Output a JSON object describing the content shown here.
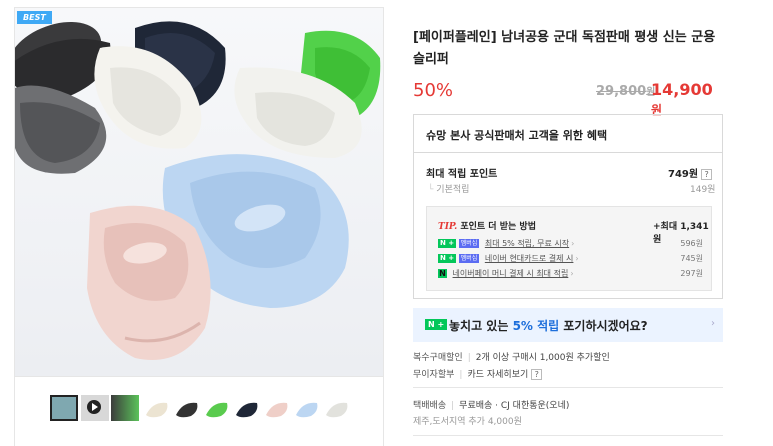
{
  "gallery": {
    "badge": "BEST",
    "thumbnails": [
      "collage",
      "video",
      "mixed-colors",
      "cream",
      "black",
      "green",
      "navy",
      "pink",
      "sky-blue",
      "white"
    ]
  },
  "product": {
    "title": "[페이퍼플레인] 남녀공용 군대 독점판매 평생 신는 군용슬리퍼",
    "discount": "50%",
    "original_price": "29,800",
    "original_unit": "원",
    "price": "14,900",
    "price_unit": "원"
  },
  "benefit": {
    "title": "슈망 본사 공식판매처 고객을 위한 혜택",
    "points_label": "최대 적립 포인트",
    "points_value": "749원",
    "help": "?",
    "basic_label": "기본적립",
    "basic_value": "149원",
    "tip_label": "TIP.",
    "tip_title": "포인트 더 받는 방법",
    "tip_max": "+최대 1,341 원",
    "tip_rows": [
      {
        "badge": "N +",
        "badge2": "멤버십",
        "text": "최대 5% 적립, 무료 시작",
        "amount": "596원"
      },
      {
        "badge": "N +",
        "badge2": "멤버십",
        "text": "네이버 현대카드로 결제 시",
        "amount": "745원"
      },
      {
        "badge": "N",
        "text": "네이버페이 머니 결제 시 최대 적립",
        "amount": "297원"
      }
    ]
  },
  "promo": {
    "badge": "N +",
    "text_before": "놓치고 있는 ",
    "text_highlight": "5% 적립",
    "text_after": " 포기하시겠어요?"
  },
  "purchase": {
    "multi_label": "복수구매할인",
    "multi_value": "2개 이상 구매시 1,000원 추가할인",
    "interest_label": "무이자할부",
    "interest_value": "카드 자세히보기",
    "shipping_label": "택배배송",
    "shipping_value": "무료배송 · CJ 대한통운(오네)",
    "shipping_extra": "제주,도서지역 추가 4,000원"
  },
  "colors": {
    "accent_red": "#e53935",
    "naver_green": "#03c75a",
    "highlight_blue": "#1e6fdb",
    "badge_blue": "#3fa9f5"
  }
}
